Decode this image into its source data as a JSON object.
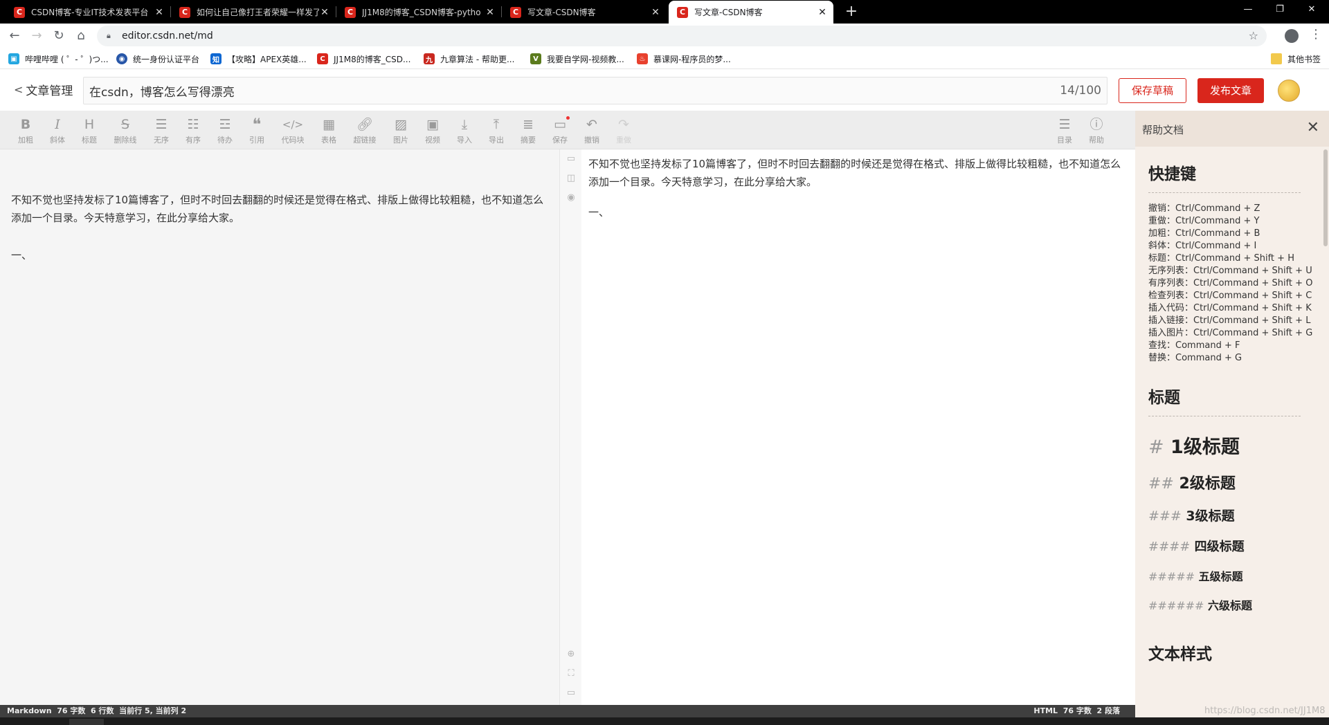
{
  "browser": {
    "tabs": [
      {
        "title": "CSDN博客-专业IT技术发表平台",
        "active": false
      },
      {
        "title": "如何让自己像打王者荣耀一样发了",
        "active": false
      },
      {
        "title": "JJ1M8的博客_CSDN博客-pytho",
        "active": false
      },
      {
        "title": "写文章-CSDN博客",
        "active": false
      },
      {
        "title": "写文章-CSDN博客",
        "active": true
      }
    ],
    "url": "editor.csdn.net/md",
    "bookmarks": [
      {
        "label": "哔哩哔哩 ( ゜- ゜)つ...",
        "color": "#23a6e0"
      },
      {
        "label": "统一身份认证平台",
        "color": "#2756a8"
      },
      {
        "label": "【攻略】APEX英雄...",
        "color": "#0e67d2"
      },
      {
        "label": "JJ1M8的博客_CSD...",
        "color": "#d9261c"
      },
      {
        "label": "九章算法 - 帮助更...",
        "color": "#c9281f"
      },
      {
        "label": "我要自学网-视频教...",
        "color": "#5b7b1d"
      },
      {
        "label": "慕课网-程序员的梦...",
        "color": "#e8412e"
      }
    ],
    "other_bookmarks": "其他书签"
  },
  "editor": {
    "back_label": "文章管理",
    "title": "在csdn，博客怎么写得漂亮",
    "title_counter": "14/100",
    "save_draft": "保存草稿",
    "publish": "发布文章",
    "accent": "#d9261c"
  },
  "toolbar": {
    "bold": "加粗",
    "italic": "斜体",
    "heading": "标题",
    "strike": "删除线",
    "ul": "无序",
    "ol": "有序",
    "todo": "待办",
    "quote": "引用",
    "code": "代码块",
    "table": "表格",
    "link": "超链接",
    "image": "图片",
    "video": "视频",
    "import": "导入",
    "export": "导出",
    "summary": "摘要",
    "save": "保存",
    "undo": "撤销",
    "redo": "重做",
    "toc": "目录",
    "help": "帮助"
  },
  "content": {
    "paragraph": "不知不觉也坚持发标了10篇博客了，但时不时回去翻翻的时候还是觉得在格式、排版上做得比较粗糙，也不知道怎么添加一个目录。今天特意学习，在此分享给大家。",
    "line2": "一、"
  },
  "help": {
    "title": "帮助文档",
    "shortcuts_heading": "快捷键",
    "shortcuts": [
      "撤销：Ctrl/Command + Z",
      "重做：Ctrl/Command + Y",
      "加粗：Ctrl/Command + B",
      "斜体：Ctrl/Command + I",
      "标题：Ctrl/Command + Shift + H",
      "无序列表：Ctrl/Command + Shift + U",
      "有序列表：Ctrl/Command + Shift + O",
      "检查列表：Ctrl/Command + Shift + C",
      "插入代码：Ctrl/Command + Shift + K",
      "插入链接：Ctrl/Command + Shift + L",
      "插入图片：Ctrl/Command + Shift + G",
      "查找：Command + F",
      "替换：Command + G"
    ],
    "headings_heading": "标题",
    "headings": [
      {
        "hash": "#",
        "label": "1级标题"
      },
      {
        "hash": "##",
        "label": "2级标题"
      },
      {
        "hash": "###",
        "label": "3级标题"
      },
      {
        "hash": "####",
        "label": "四级标题"
      },
      {
        "hash": "#####",
        "label": "五级标题"
      },
      {
        "hash": "######",
        "label": "六级标题"
      }
    ],
    "text_style_heading": "文本样式"
  },
  "status": {
    "left": "Markdown  76 字数  6 行数  当前行 5, 当前列 2",
    "right": "HTML  76 字数  2 段落"
  },
  "watermark": "https://blog.csdn.net/JJ1M8"
}
